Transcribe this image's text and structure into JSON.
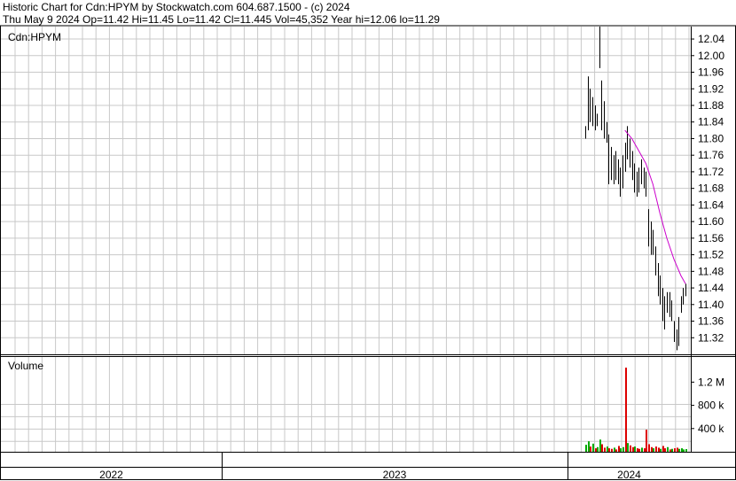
{
  "header": {
    "line1": "Historic Chart for Cdn:HPYM by Stockwatch.com 604.687.1500 - (c) 2024",
    "line2": "Thu May  9 2024  Op=11.42  Hi=11.45  Lo=11.42  Cl=11.445  Vol=45,352  Year hi=12.06  lo=11.29"
  },
  "colors": {
    "ma": "#cc00cc",
    "vol_up": "#00aa00",
    "vol_down": "#dd0000",
    "grid": "#c8c8c8",
    "bars": "#000000"
  },
  "chart_data": [
    {
      "type": "ohlc",
      "title": "Cdn:HPYM",
      "ylim": [
        11.28,
        12.07
      ],
      "yticks": [
        "12.04",
        "12.00",
        "11.96",
        "11.92",
        "11.88",
        "11.84",
        "11.80",
        "11.76",
        "11.72",
        "11.68",
        "11.64",
        "11.60",
        "11.56",
        "11.52",
        "11.48",
        "11.44",
        "11.40",
        "11.36",
        "11.32"
      ],
      "x_periods": [
        "2022",
        "2023",
        "2024"
      ],
      "grid": true,
      "series": [
        {
          "type": "ohlc",
          "points": [
            {
              "x": 0,
              "h": 11.83,
              "l": 11.8
            },
            {
              "x": 1,
              "h": 11.95,
              "l": 11.82
            },
            {
              "x": 2,
              "h": 11.92,
              "l": 11.84
            },
            {
              "x": 3,
              "h": 11.9,
              "l": 11.83
            },
            {
              "x": 4,
              "h": 11.88,
              "l": 11.82
            },
            {
              "x": 5,
              "h": 11.86,
              "l": 11.83
            },
            {
              "x": 6,
              "h": 12.07,
              "l": 11.97
            },
            {
              "x": 7,
              "h": 11.94,
              "l": 11.82
            },
            {
              "x": 8,
              "h": 11.89,
              "l": 11.8
            },
            {
              "x": 9,
              "h": 11.84,
              "l": 11.79
            },
            {
              "x": 10,
              "h": 11.81,
              "l": 11.69
            },
            {
              "x": 11,
              "h": 11.78,
              "l": 11.7
            },
            {
              "x": 12,
              "h": 11.76,
              "l": 11.69
            },
            {
              "x": 13,
              "h": 11.77,
              "l": 11.7
            },
            {
              "x": 14,
              "h": 11.75,
              "l": 11.69
            },
            {
              "x": 15,
              "h": 11.73,
              "l": 11.66
            },
            {
              "x": 16,
              "h": 11.76,
              "l": 11.68
            },
            {
              "x": 17,
              "h": 11.79,
              "l": 11.72
            },
            {
              "x": 18,
              "h": 11.83,
              "l": 11.75
            },
            {
              "x": 19,
              "h": 11.8,
              "l": 11.73
            },
            {
              "x": 20,
              "h": 11.77,
              "l": 11.7
            },
            {
              "x": 21,
              "h": 11.74,
              "l": 11.67
            },
            {
              "x": 22,
              "h": 11.72,
              "l": 11.66
            },
            {
              "x": 23,
              "h": 11.73,
              "l": 11.67
            },
            {
              "x": 24,
              "h": 11.75,
              "l": 11.69
            },
            {
              "x": 25,
              "h": 11.73,
              "l": 11.68
            },
            {
              "x": 26,
              "h": 11.72,
              "l": 11.66
            },
            {
              "x": 27,
              "h": 11.63,
              "l": 11.54
            },
            {
              "x": 28,
              "h": 11.6,
              "l": 11.52
            },
            {
              "x": 29,
              "h": 11.58,
              "l": 11.52
            },
            {
              "x": 30,
              "h": 11.54,
              "l": 11.47
            },
            {
              "x": 31,
              "h": 11.5,
              "l": 11.42
            },
            {
              "x": 32,
              "h": 11.47,
              "l": 11.4
            },
            {
              "x": 33,
              "h": 11.44,
              "l": 11.36
            },
            {
              "x": 34,
              "h": 11.42,
              "l": 11.34
            },
            {
              "x": 35,
              "h": 11.43,
              "l": 11.38
            },
            {
              "x": 36,
              "h": 11.43,
              "l": 11.37
            },
            {
              "x": 37,
              "h": 11.41,
              "l": 11.36
            },
            {
              "x": 38,
              "h": 11.36,
              "l": 11.31
            },
            {
              "x": 39,
              "h": 11.34,
              "l": 11.29
            },
            {
              "x": 40,
              "h": 11.37,
              "l": 11.3
            },
            {
              "x": 41,
              "h": 11.42,
              "l": 11.38
            },
            {
              "x": 42,
              "h": 11.44,
              "l": 11.4
            },
            {
              "x": 43,
              "h": 11.45,
              "l": 11.42
            }
          ]
        },
        {
          "type": "line",
          "points": [
            {
              "x": 17,
              "y": 11.82
            },
            {
              "x": 20,
              "y": 11.8
            },
            {
              "x": 23,
              "y": 11.77
            },
            {
              "x": 26,
              "y": 11.74
            },
            {
              "x": 29,
              "y": 11.69
            },
            {
              "x": 32,
              "y": 11.62
            },
            {
              "x": 35,
              "y": 11.56
            },
            {
              "x": 38,
              "y": 11.51
            },
            {
              "x": 41,
              "y": 11.47
            },
            {
              "x": 43,
              "y": 11.45
            }
          ]
        }
      ]
    },
    {
      "type": "bar",
      "title": "Volume",
      "ylim": [
        0,
        1450000
      ],
      "yticks": [
        "1.2 M",
        "800 k",
        "400 k"
      ],
      "series": [
        {
          "bars": [
            {
              "x": 0,
              "v": 120000,
              "c": "up"
            },
            {
              "x": 1,
              "v": 180000,
              "c": "up"
            },
            {
              "x": 2,
              "v": 90000,
              "c": "down"
            },
            {
              "x": 3,
              "v": 140000,
              "c": "up"
            },
            {
              "x": 4,
              "v": 60000,
              "c": "down"
            },
            {
              "x": 5,
              "v": 80000,
              "c": "up"
            },
            {
              "x": 6,
              "v": 210000,
              "c": "up"
            },
            {
              "x": 7,
              "v": 130000,
              "c": "down"
            },
            {
              "x": 8,
              "v": 70000,
              "c": "down"
            },
            {
              "x": 9,
              "v": 90000,
              "c": "up"
            },
            {
              "x": 10,
              "v": 60000,
              "c": "down"
            },
            {
              "x": 11,
              "v": 50000,
              "c": "down"
            },
            {
              "x": 12,
              "v": 70000,
              "c": "up"
            },
            {
              "x": 13,
              "v": 40000,
              "c": "down"
            },
            {
              "x": 14,
              "v": 100000,
              "c": "down"
            },
            {
              "x": 15,
              "v": 60000,
              "c": "up"
            },
            {
              "x": 16,
              "v": 80000,
              "c": "up"
            },
            {
              "x": 17,
              "v": 1450000,
              "c": "down"
            },
            {
              "x": 18,
              "v": 150000,
              "c": "up"
            },
            {
              "x": 19,
              "v": 110000,
              "c": "down"
            },
            {
              "x": 20,
              "v": 80000,
              "c": "down"
            },
            {
              "x": 21,
              "v": 90000,
              "c": "up"
            },
            {
              "x": 22,
              "v": 60000,
              "c": "down"
            },
            {
              "x": 23,
              "v": 50000,
              "c": "down"
            },
            {
              "x": 24,
              "v": 70000,
              "c": "up"
            },
            {
              "x": 25,
              "v": 60000,
              "c": "down"
            },
            {
              "x": 26,
              "v": 380000,
              "c": "down"
            },
            {
              "x": 27,
              "v": 130000,
              "c": "down"
            },
            {
              "x": 28,
              "v": 80000,
              "c": "down"
            },
            {
              "x": 29,
              "v": 60000,
              "c": "up"
            },
            {
              "x": 30,
              "v": 90000,
              "c": "down"
            },
            {
              "x": 31,
              "v": 70000,
              "c": "down"
            },
            {
              "x": 32,
              "v": 50000,
              "c": "up"
            },
            {
              "x": 33,
              "v": 100000,
              "c": "down"
            },
            {
              "x": 34,
              "v": 60000,
              "c": "down"
            },
            {
              "x": 35,
              "v": 80000,
              "c": "up"
            },
            {
              "x": 36,
              "v": 40000,
              "c": "down"
            },
            {
              "x": 37,
              "v": 50000,
              "c": "up"
            },
            {
              "x": 38,
              "v": 60000,
              "c": "down"
            },
            {
              "x": 39,
              "v": 70000,
              "c": "down"
            },
            {
              "x": 40,
              "v": 50000,
              "c": "up"
            },
            {
              "x": 41,
              "v": 60000,
              "c": "up"
            },
            {
              "x": 42,
              "v": 40000,
              "c": "up"
            },
            {
              "x": 43,
              "v": 45352,
              "c": "up"
            }
          ]
        }
      ]
    }
  ]
}
